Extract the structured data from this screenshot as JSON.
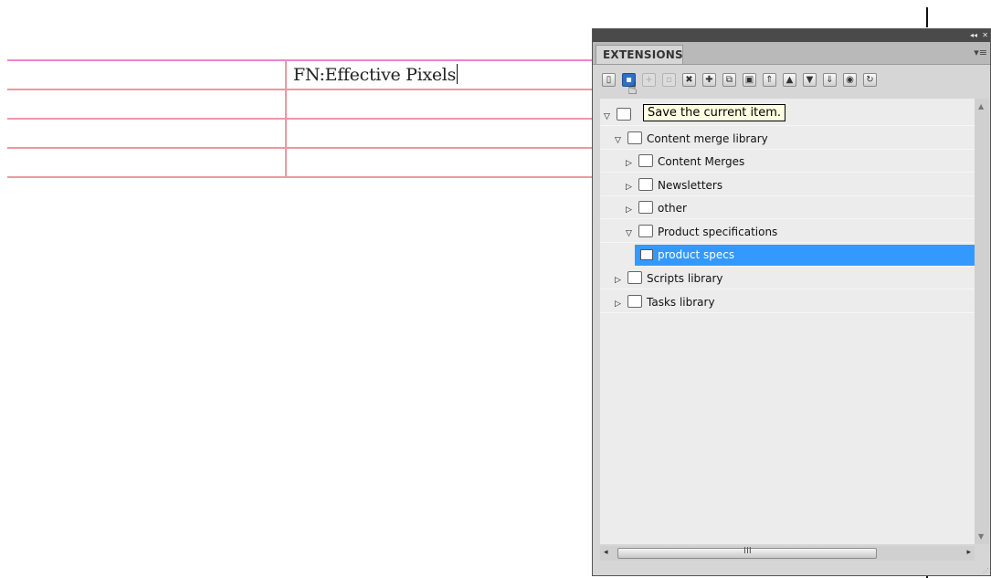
{
  "document": {
    "cell_text": "FN:Effective Pixels"
  },
  "panel": {
    "title_collapse_icon": "◂◂",
    "title_close_icon": "✕",
    "tab_label": "EXTENSIONS",
    "menu_icon": "▾≡",
    "toolbar_buttons": [
      {
        "name": "new-item",
        "glyph": "▯"
      },
      {
        "name": "save",
        "glyph": "▪"
      },
      {
        "name": "add",
        "glyph": "+"
      },
      {
        "name": "edit",
        "glyph": "▫"
      },
      {
        "name": "delete",
        "glyph": "✖"
      },
      {
        "name": "move",
        "glyph": "✚"
      },
      {
        "name": "copy",
        "glyph": "⧉"
      },
      {
        "name": "paste",
        "glyph": "▣"
      },
      {
        "name": "move-top",
        "glyph": "⇑"
      },
      {
        "name": "move-up",
        "glyph": "▲"
      },
      {
        "name": "move-down",
        "glyph": "▼"
      },
      {
        "name": "move-bottom",
        "glyph": "⇓"
      },
      {
        "name": "settings",
        "glyph": "◉"
      },
      {
        "name": "refresh",
        "glyph": "↻"
      }
    ],
    "tooltip": "Save the current item.",
    "tree": [
      {
        "label": "",
        "expanded": true,
        "depth": 0
      },
      {
        "label": "Content merge library",
        "expanded": true,
        "depth": 1
      },
      {
        "label": "Content Merges",
        "expanded": false,
        "depth": 2
      },
      {
        "label": "Newsletters",
        "expanded": false,
        "depth": 2
      },
      {
        "label": "other",
        "expanded": false,
        "depth": 2
      },
      {
        "label": "Product specifications",
        "expanded": true,
        "depth": 2
      },
      {
        "label": "product specs",
        "depth": 3,
        "selected": true,
        "leaf": true
      },
      {
        "label": "Scripts library",
        "expanded": false,
        "depth": 1
      },
      {
        "label": "Tasks library",
        "expanded": false,
        "depth": 1
      }
    ],
    "scroll_grip": "III"
  }
}
